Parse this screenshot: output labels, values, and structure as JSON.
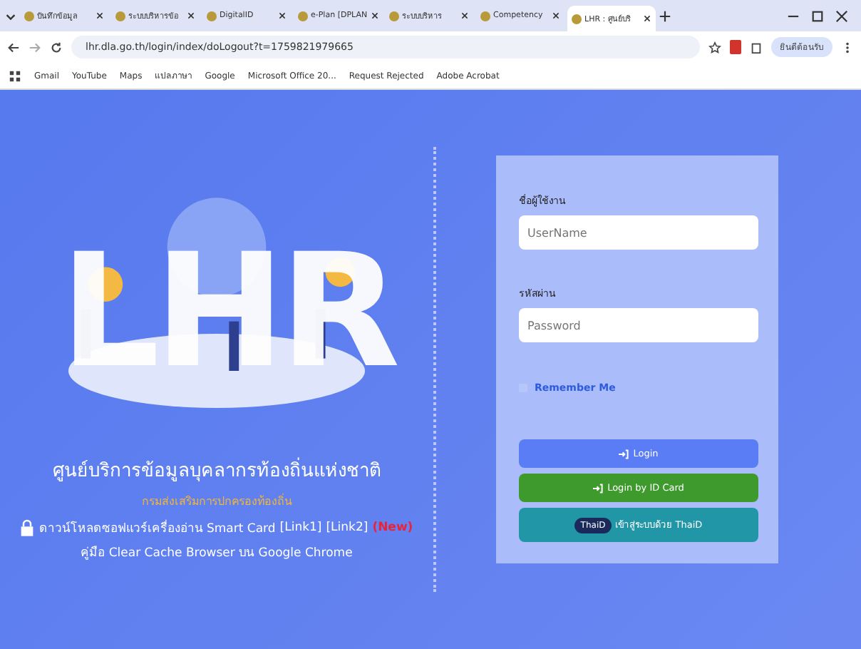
{
  "browser": {
    "tabs": [
      {
        "title": "บันทึกข้อมูล",
        "selected": false
      },
      {
        "title": "ระบบบริหารข้อ",
        "selected": false
      },
      {
        "title": "DigitalID",
        "selected": false
      },
      {
        "title": "e-Plan [DPLAN",
        "selected": false
      },
      {
        "title": "ระบบบริหาร",
        "selected": false
      },
      {
        "title": "Competency",
        "selected": false
      },
      {
        "title": "LHR : ศูนย์บริ",
        "selected": true
      }
    ],
    "url": "lhr.dla.go.th/login/index/doLogout?t=1759821979665",
    "profile": "ยินดีต้อนรับ",
    "bookmarks": [
      "Gmail",
      "YouTube",
      "Maps",
      "แปลภาษา",
      "Google",
      "Microsoft Office 20...",
      "Request Rejected",
      "Adobe Acrobat"
    ]
  },
  "hero": {
    "logo": "LHR",
    "title": "ศูนย์บริการข้อมูลบุคลากรท้องถิ่นแห่งชาติ",
    "subtitle": "กรมส่งเสริมการปกครองท้องถิ่น",
    "download_text": "ดาวน์โหลดซอฟแวร์เครื่องอ่าน Smart Card",
    "links": [
      "[Link1]",
      "[Link2]"
    ],
    "new_badge": "(New)",
    "manual": "คู่มือ Clear Cache Browser บน Google Chrome"
  },
  "login": {
    "username_label": "ชื่อผู้ใช้งาน",
    "username_placeholder": "UserName",
    "password_label": "รหัสผ่าน",
    "password_placeholder": "Password",
    "remember": {
      "label": "Remember Me",
      "checked": false
    },
    "buttons": [
      {
        "kind": "login",
        "label": "Login"
      },
      {
        "kind": "idcard",
        "label": "Login by ID Card"
      },
      {
        "kind": "thaid",
        "label": "เข้าสู่ระบบด้วย ThaiD",
        "badge": "ThaiD"
      }
    ]
  }
}
